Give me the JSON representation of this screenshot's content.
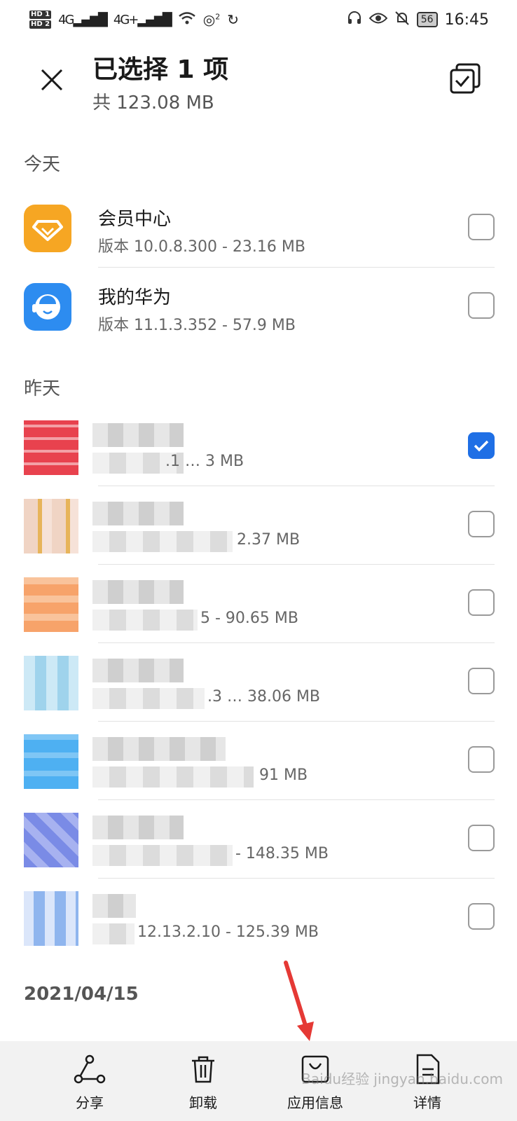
{
  "status_bar": {
    "hd_labels": [
      "HD 1",
      "HD 2"
    ],
    "network_1": "4G",
    "network_2": "4G+",
    "hotspot_count": "2",
    "battery": "56",
    "time": "16:45"
  },
  "header": {
    "title": "已选择 1 项",
    "subtitle": "共 123.08 MB"
  },
  "sections": [
    {
      "label": "今天",
      "apps": [
        {
          "name": "会员中心",
          "meta": "版本 10.0.8.300 - 23.16 MB",
          "checked": false,
          "icon_color": "#f6a623"
        },
        {
          "name": "我的华为",
          "meta": "版本 11.1.3.352 - 57.9 MB",
          "checked": false,
          "icon_color": "#2d8cf0"
        }
      ]
    },
    {
      "label": "昨天",
      "apps": [
        {
          "meta_visible": ".1 … 3 MB",
          "checked": true,
          "icon_color": "#e8424e"
        },
        {
          "meta_visible": "2.37 MB",
          "checked": false,
          "icon_color": "#e7c2a0"
        },
        {
          "meta_visible": "5 - 90.65 MB",
          "checked": false,
          "icon_color": "#f7a36a"
        },
        {
          "meta_visible": ".3 … 38.06 MB",
          "checked": false,
          "icon_color": "#9fd3ec"
        },
        {
          "meta_visible": "91 MB",
          "checked": false,
          "icon_color": "#4eb0f2"
        },
        {
          "meta_visible": "- 148.35 MB",
          "checked": false,
          "icon_color": "#7a8be6"
        },
        {
          "meta_visible": "12.13.2.10 - 125.39 MB",
          "checked": false,
          "icon_color": "#8fb5ee"
        }
      ]
    },
    {
      "label": "2021/04/15",
      "apps": []
    }
  ],
  "bottom_actions": [
    {
      "label": "分享",
      "icon": "share-icon"
    },
    {
      "label": "卸载",
      "icon": "trash-icon"
    },
    {
      "label": "应用信息",
      "icon": "bag-icon"
    },
    {
      "label": "详情",
      "icon": "document-icon"
    }
  ],
  "watermark": "Baidu经验 jingyan.baidu.com",
  "colors": {
    "accent": "#1f6fe5",
    "arrow": "#e53935"
  }
}
